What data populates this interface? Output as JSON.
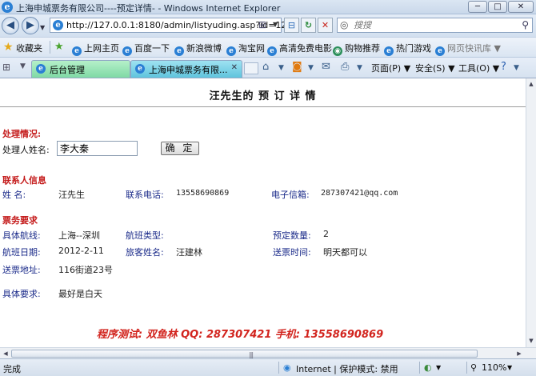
{
  "window": {
    "title": "上海申城票务有限公司----预定详情- - Windows Internet Explorer",
    "min_glyph": "─",
    "max_glyph": "□",
    "close_glyph": "✕"
  },
  "address": {
    "url": "http://127.0.0.1:8180/admin/listyuding.asp?id=12",
    "search_placeholder": "搜搜"
  },
  "favorites": {
    "label": "收藏夹",
    "items": [
      "上网主页",
      "百度一下",
      "新浪微博",
      "淘宝网",
      "高清免费电影",
      "购物推荐",
      "热门游戏",
      "网页快讯库"
    ]
  },
  "tabs": [
    {
      "label": "后台管理"
    },
    {
      "label": "上海申城票务有限..."
    }
  ],
  "commands": {
    "page": "页面(P)",
    "safety": "安全(S)",
    "tools": "工具(O)"
  },
  "page": {
    "title": "汪先生的  预  订  详  情",
    "processing": {
      "heading": "处理情况:",
      "handler_label": "处理人姓名:",
      "handler_value": "李大秦",
      "confirm_label": "确  定"
    },
    "contact": {
      "heading": "联系人信息",
      "name_label": "姓    名:",
      "name_value": "汪先生",
      "phone_label": "联系电话:",
      "phone_value": "13558690869",
      "email_label": "电子信箱:",
      "email_value": "287307421@qq.com"
    },
    "ticket": {
      "heading": "票务要求",
      "route_label": "具体航线:",
      "route_value": "上海--深圳",
      "flight_type_label": "航班类型:",
      "flight_type_value": "",
      "quantity_label": "预定数量:",
      "quantity_value": "2",
      "date_label": "航班日期:",
      "date_value": "2012-2-11",
      "passenger_label": "旅客姓名:",
      "passenger_value": "汪建林",
      "delivery_time_label": "送票时间:",
      "delivery_time_value": "明天都可以",
      "address_label": "送票地址:",
      "address_value": "116街道23号",
      "request_label": "具体要求:",
      "request_value": "最好是白天"
    },
    "credit": "程序测试: 双鱼林   QQ: 287307421   手机: 13558690869"
  },
  "status": {
    "left": "完成",
    "zone": "Internet | 保护模式: 禁用",
    "zoom": "110%"
  }
}
